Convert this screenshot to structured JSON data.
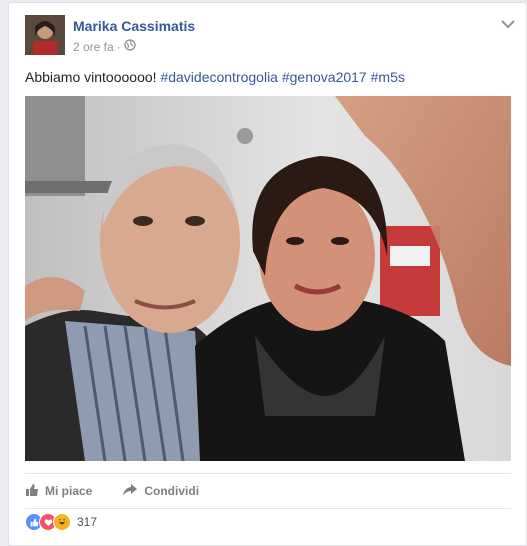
{
  "post": {
    "author": "Marika Cassimatis",
    "time": "2 ore fa",
    "text_plain": "Abbiamo vintoooooo! ",
    "hashtags": [
      "#davidecontrogolia",
      "#genova2017",
      "#m5s"
    ]
  },
  "actions": {
    "like": "Mi piace",
    "share": "Condividi"
  },
  "reactions": {
    "count": "317"
  },
  "colors": {
    "link": "#365899",
    "like_blue": "#5890ff",
    "love_red": "#f25268",
    "haha_yellow": "#f7b125"
  }
}
